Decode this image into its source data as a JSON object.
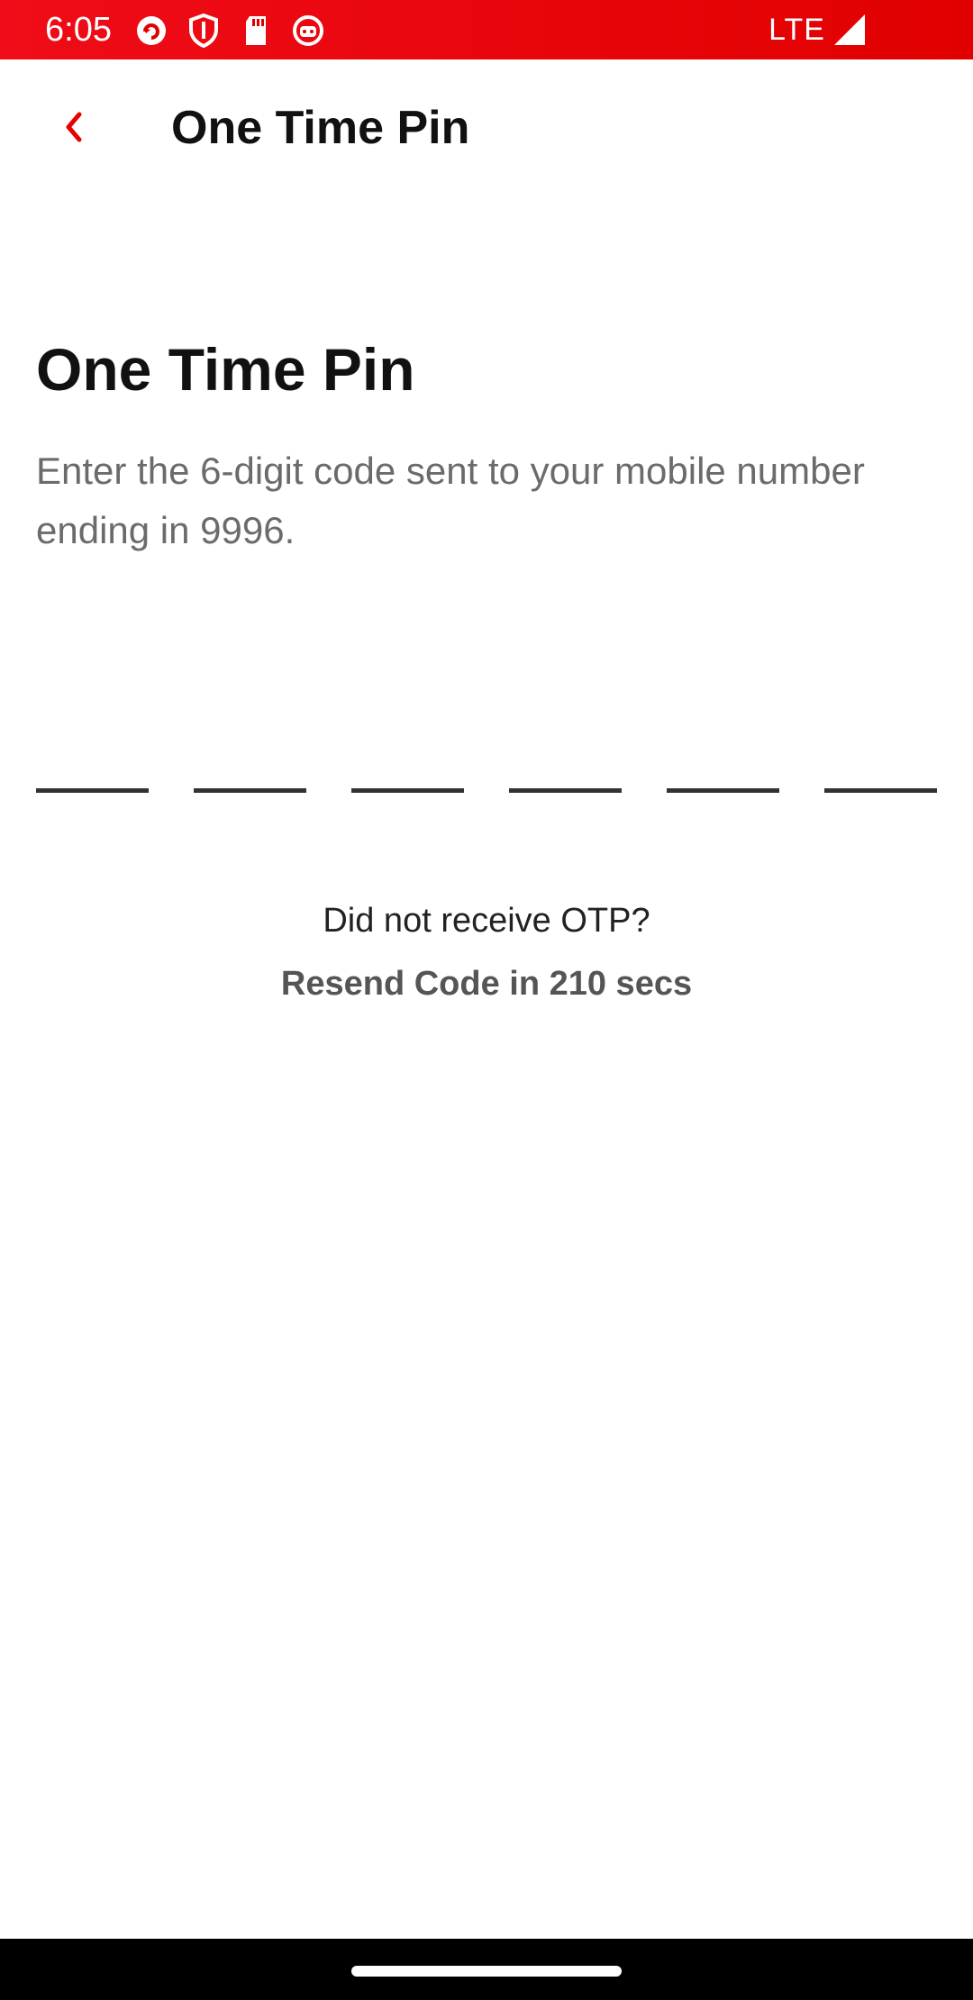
{
  "status_bar": {
    "time": "6:05",
    "network": "LTE",
    "icons": [
      "app-refresh-icon",
      "shield-icon",
      "sd-card-icon",
      "robot-icon",
      "signal-icon"
    ]
  },
  "app_bar": {
    "title": "One Time Pin",
    "back_icon": "chevron-left-icon"
  },
  "main": {
    "heading": "One Time Pin",
    "description": "Enter the 6-digit code sent to your mobile number ending in 9996.",
    "otp_digits": [
      "",
      "",
      "",
      "",
      "",
      ""
    ],
    "resend_prompt": "Did not receive OTP?",
    "resend_label": "Resend Code in 210 secs"
  },
  "colors": {
    "status_bar": "#e10000",
    "accent": "#e60000",
    "text_primary": "#111111",
    "text_secondary": "#6b6b6b"
  }
}
